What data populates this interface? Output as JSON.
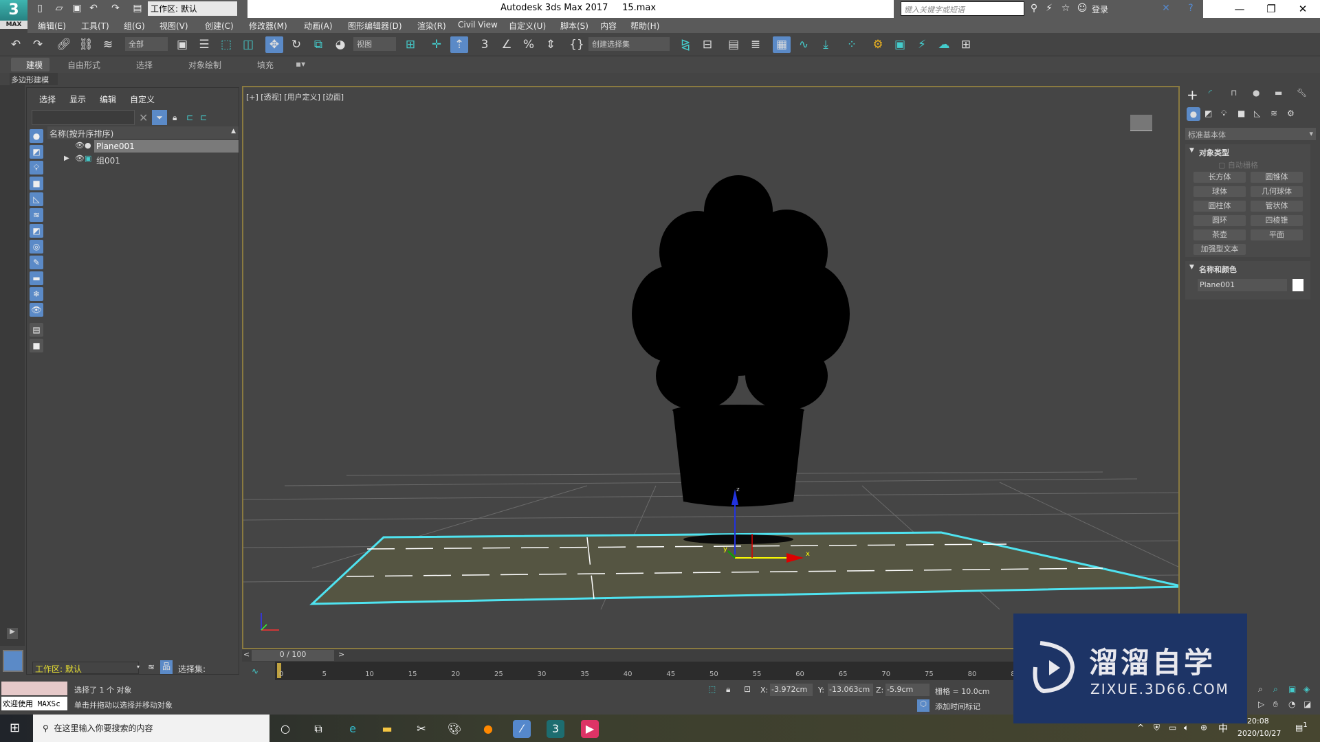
{
  "title": {
    "app": "Autodesk 3ds Max 2017",
    "file": "15.max",
    "workspace": "工作区: 默认",
    "search_placeholder": "键入关键字或短语",
    "login": "登录",
    "logo": "3",
    "logo_sub": "MAX"
  },
  "menus": [
    "编辑(E)",
    "工具(T)",
    "组(G)",
    "视图(V)",
    "创建(C)",
    "修改器(M)",
    "动画(A)",
    "图形编辑器(D)",
    "渲染(R)",
    "Civil View",
    "自定义(U)",
    "脚本(S)",
    "内容",
    "帮助(H)"
  ],
  "toolbar": {
    "filter": "全部",
    "coord_system": "视图",
    "named_selection": "创建选择集"
  },
  "ribbon": {
    "tabs": [
      "建模",
      "自由形式",
      "选择",
      "对象绘制",
      "填充"
    ],
    "sub": "多边形建模"
  },
  "explorer": {
    "menus": [
      "选择",
      "显示",
      "编辑",
      "自定义"
    ],
    "column_header": "名称(按升序排序)",
    "items": [
      {
        "name": "Plane001",
        "selected": true
      },
      {
        "name": "组001",
        "selected": false
      }
    ],
    "workspace": "工作区: 默认",
    "selection_set_label": "选择集:"
  },
  "viewport": {
    "labels": "[+] [透视] [用户定义] [边面]",
    "axis_x": "x",
    "axis_y": "y",
    "axis_z": "z"
  },
  "command_panel": {
    "category": "标准基本体",
    "rollout_object_type": "对象类型",
    "autogrid": "自动栅格",
    "buttons": [
      "长方体",
      "圆锥体",
      "球体",
      "几何球体",
      "圆柱体",
      "管状体",
      "圆环",
      "四棱锥",
      "茶壶",
      "平面",
      "加强型文本"
    ],
    "rollout_name_color": "名称和颜色",
    "object_name": "Plane001",
    "object_color": "#ffffff"
  },
  "timeline": {
    "frame": "0 / 100",
    "ticks": [
      "0",
      "5",
      "10",
      "15",
      "20",
      "25",
      "30",
      "35",
      "40",
      "45",
      "50",
      "55",
      "60",
      "65",
      "70",
      "75",
      "80",
      "85"
    ]
  },
  "status": {
    "maxscript": "欢迎使用 MAXSc",
    "line1": "选择了 1 个 对象",
    "line2": "单击并拖动以选择并移动对象",
    "x_label": "X:",
    "x": "-3.972cm",
    "y_label": "Y:",
    "y": "-13.063cm",
    "z_label": "Z:",
    "z": "-5.9cm",
    "grid": "栅格 = 10.0cm",
    "add_tag": "添加时间标记"
  },
  "taskbar": {
    "search": "在这里输入你要搜索的内容",
    "time": "20:08",
    "date": "2020/10/27",
    "ime": "中",
    "notifications": "1"
  },
  "watermark": {
    "name": "溜溜自学",
    "url": "ZIXUE.3D66.COM"
  },
  "colors": {
    "accent": "#5b8ac7",
    "selection": "#4fe3f0",
    "viewport_border": "#8a7a40"
  }
}
